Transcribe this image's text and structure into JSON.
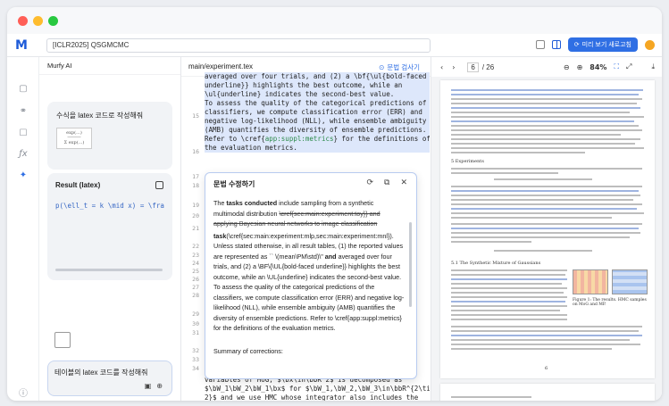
{
  "window": {
    "dots": [
      "#ff5f57",
      "#febc2e",
      "#28c840"
    ]
  },
  "topbar": {
    "logo": "M",
    "project_name": "[ICLR2025] QSGMCMC",
    "preview_label": "미리 보기 새로고침"
  },
  "ai_panel": {
    "title": "Murfy AI",
    "prompt1": "수식을 latex 코드로 작성해줘",
    "formula_image": "exp(...) / Σ exp(...)",
    "result_title": "Result (latex)",
    "result_code": "p(\\ell_t = k \\mid x) = \\frac",
    "input_text": "테이블의 latex 코드를 작성해줘"
  },
  "editor": {
    "file_name": "main/experiment.tex",
    "check_label": "문법 검사기",
    "line_numbers": [
      "15",
      "16",
      "17",
      "18",
      "19",
      "20",
      "21",
      "22",
      "23",
      "24",
      "25",
      "26",
      "27",
      "28",
      "29",
      "30",
      "31",
      "32",
      "33",
      "34"
    ],
    "code_top": [
      "averaged over four trials, and (2) a \\bf{\\ul{bold-faced",
      "underline}} highlights the best outcome, while an",
      "\\ul{underline} indicates the second-best value.",
      "To assess the quality of the categorical predictions of the",
      "classifiers, we compute classification error (ERR) and",
      "negative log-likelihood (NLL), while ensemble ambiguity",
      "(AMB) quantifies the diversity of ensemble predictions.",
      "Refer to \\cref{",
      "app:suppl:metrics",
      "} for the definitions of",
      "the evaluation metrics."
    ],
    "code_bottom": [
      "variables of MoG, $\\bx\\in\\bbR^2$ is decomposed as",
      "$\\bW_1\\bW_2\\bW_1\\bx$ for $\\bW_1,\\bW_2,\\bW_3\\in\\bbR^{2\\times",
      "2}$ and we use HMC whose integrator also includes the"
    ]
  },
  "popup": {
    "title": "문법 수정하기",
    "body_lead": "The ",
    "body_bold1": "tasks conducted",
    "body_after_bold1": " include sampling from a synthetic multimodal distribution",
    "body_strike": "\\cref{sec:main:experiment:toy}} and applying Bayesian neural networks to image classification",
    "body_task": "task",
    "body_p2": "(\\cref{sec:main:experiment:mlp,sec:main:experiment:mnl}). Unless stated otherwise, in all result tables, (1) the reported values are represented as `` \\(mean\\PM\\std)\\\" ",
    "body_bold2": "and",
    "body_p3": " averaged over four trials, and (2) a \\BF\\{\\UL{bold-faced underline}} highlights the best outcome, while an \\UL{underline} indicates the second-best value. To assess the quality of the categorical predictions of the classifiers, we compute classification error (ERR) and negative log-likelihood (NLL), while ensemble ambiguity (AMB) quantifies the diversity of ensemble predictions. Refer to \\cref{app:suppl:metrics} for the definitions of the evaluation metrics.",
    "summary": "Summary of corrections:"
  },
  "pdf": {
    "page_current": "6",
    "page_total": "/ 26",
    "zoom": "84%",
    "section_label": "5   Experiments",
    "subsection_label": "5.1   The Synthetic Mixture of Gaussians",
    "figure_caption": "Figure 1: The results. HMC samples on MoG and MP.",
    "footer_page": "6"
  }
}
